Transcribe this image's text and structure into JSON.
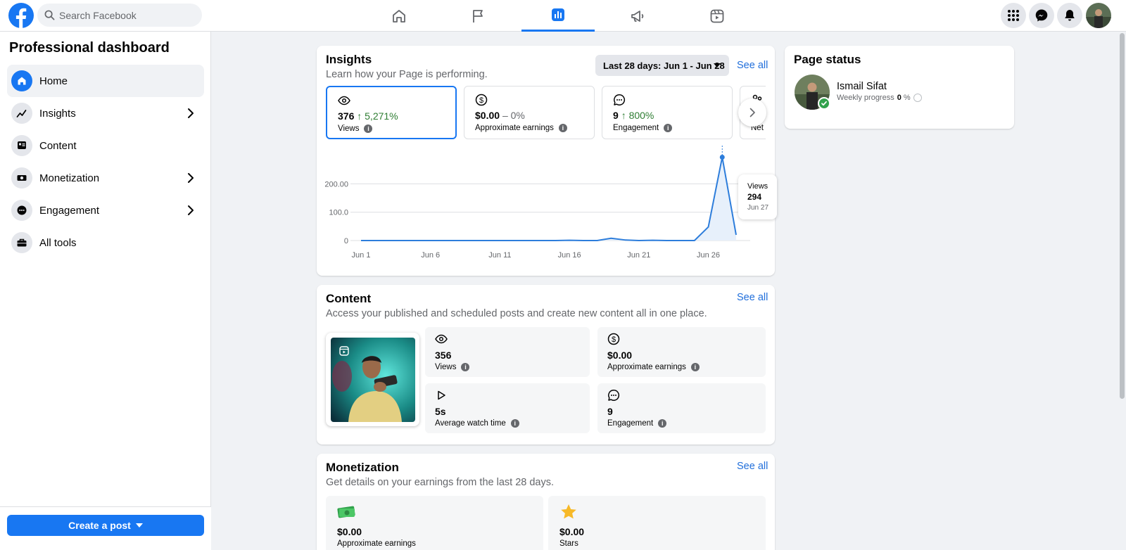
{
  "header": {
    "search_placeholder": "Search Facebook",
    "nav_tabs": [
      {
        "icon": "home-icon",
        "active": false
      },
      {
        "icon": "flag-icon",
        "active": false
      },
      {
        "icon": "dashboard-icon",
        "active": true
      },
      {
        "icon": "megaphone-icon",
        "active": false
      },
      {
        "icon": "reels-icon",
        "active": false
      }
    ],
    "right_icons": [
      "menu-grid-icon",
      "messenger-icon",
      "notifications-icon",
      "profile-avatar"
    ],
    "accent_color": "#1877f2"
  },
  "sidebar": {
    "title": "Professional dashboard",
    "items": [
      {
        "label": "Home",
        "icon": "home-icon",
        "active": true,
        "has_chevron": false
      },
      {
        "label": "Insights",
        "icon": "insights-icon",
        "active": false,
        "has_chevron": true
      },
      {
        "label": "Content",
        "icon": "content-icon",
        "active": false,
        "has_chevron": false
      },
      {
        "label": "Monetization",
        "icon": "monetization-icon",
        "active": false,
        "has_chevron": true
      },
      {
        "label": "Engagement",
        "icon": "engagement-icon",
        "active": false,
        "has_chevron": true
      },
      {
        "label": "All tools",
        "icon": "toolbox-icon",
        "active": false,
        "has_chevron": false
      }
    ],
    "create_post_label": "Create a post"
  },
  "insights": {
    "title": "Insights",
    "subtitle": "Learn how your Page is performing.",
    "date_range": "Last 28 days: Jun 1 - Jun 28",
    "see_all": "See all",
    "metrics": [
      {
        "icon": "eye-icon",
        "value": "376",
        "delta": "↑ 5,271%",
        "delta_type": "up",
        "label": "Views",
        "selected": true
      },
      {
        "icon": "dollar-icon",
        "value": "$0.00",
        "delta": "– 0%",
        "delta_type": "neutral",
        "label": "Approximate earnings",
        "selected": false
      },
      {
        "icon": "chat-icon",
        "value": "9",
        "delta": "↑ 800%",
        "delta_type": "up",
        "label": "Engagement",
        "selected": false
      },
      {
        "icon": "followers-icon",
        "value": "",
        "delta": "↓",
        "delta_type": "down",
        "label": "Net foll",
        "selected": false
      }
    ],
    "tooltip": {
      "label": "Views",
      "value": "294",
      "date": "Jun 27"
    }
  },
  "chart_data": {
    "type": "area",
    "x": [
      "Jun 1",
      "Jun 2",
      "Jun 3",
      "Jun 4",
      "Jun 5",
      "Jun 6",
      "Jun 7",
      "Jun 8",
      "Jun 9",
      "Jun 10",
      "Jun 11",
      "Jun 12",
      "Jun 13",
      "Jun 14",
      "Jun 15",
      "Jun 16",
      "Jun 17",
      "Jun 18",
      "Jun 19",
      "Jun 20",
      "Jun 21",
      "Jun 22",
      "Jun 23",
      "Jun 24",
      "Jun 25",
      "Jun 26",
      "Jun 27",
      "Jun 28"
    ],
    "series": [
      {
        "name": "Views",
        "values": [
          0,
          0,
          0,
          0,
          0,
          0,
          0,
          0,
          0,
          0,
          0,
          0,
          0,
          0,
          0,
          1,
          0,
          0,
          8,
          2,
          0,
          1,
          0,
          0,
          0,
          48,
          294,
          20
        ]
      }
    ],
    "x_tick_labels": [
      "Jun 1",
      "Jun 6",
      "Jun 11",
      "Jun 16",
      "Jun 21",
      "Jun 26"
    ],
    "y_tick_labels": [
      "0",
      "100.0",
      "200.00"
    ],
    "y_ticks": [
      0,
      100,
      200
    ],
    "ylim": [
      0,
      340
    ],
    "grid": true,
    "line_color": "#2d7ddb",
    "fill_color": "#e7f0fb"
  },
  "content": {
    "title": "Content",
    "subtitle": "Access your published and scheduled posts and create new content all in one place.",
    "see_all": "See all",
    "stats": [
      {
        "icon": "eye-icon",
        "value": "356",
        "label": "Views"
      },
      {
        "icon": "dollar-icon",
        "value": "$0.00",
        "label": "Approximate earnings"
      },
      {
        "icon": "play-icon",
        "value": "5s",
        "label": "Average watch time"
      },
      {
        "icon": "chat-icon",
        "value": "9",
        "label": "Engagement"
      }
    ]
  },
  "monetization": {
    "title": "Monetization",
    "subtitle": "Get details on your earnings from the last 28 days.",
    "see_all": "See all",
    "items": [
      {
        "icon": "cash-icon",
        "value": "$0.00",
        "label": "Approximate earnings"
      },
      {
        "icon": "star-icon",
        "value": "$0.00",
        "label": "Stars"
      }
    ]
  },
  "page_status": {
    "title": "Page status",
    "name": "Ismail Sifat",
    "progress_label": "Weekly progress",
    "progress_value": "0",
    "progress_unit": "%"
  }
}
